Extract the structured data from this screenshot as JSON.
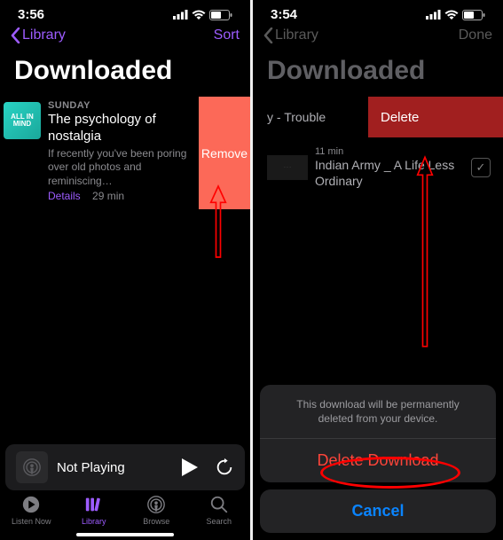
{
  "left": {
    "status": {
      "time": "3:56"
    },
    "nav": {
      "back": "Library",
      "sort": "Sort"
    },
    "title": "Downloaded",
    "episode": {
      "day": "SUNDAY",
      "title": "The psychology of nostalgia",
      "desc": "If recently you've been poring over old photos and reminiscing…",
      "details": "Details",
      "duration": "29 min"
    },
    "remove": "Remove",
    "now_playing": "Not Playing",
    "tabs": {
      "listen": "Listen Now",
      "library": "Library",
      "browse": "Browse",
      "search": "Search"
    },
    "thumb_text": "ALL\nIN\nMIND"
  },
  "right": {
    "status": {
      "time": "3:54"
    },
    "nav": {
      "back": "Library",
      "done": "Done"
    },
    "title": "Downloaded",
    "row1": {
      "label": "y - Trouble"
    },
    "delete": "Delete",
    "row2": {
      "min": "11 min",
      "title": "Indian Army _ A Life Less Ordinary"
    },
    "sheet": {
      "msg": "This download will be permanently deleted from your device.",
      "delete": "Delete Download",
      "cancel": "Cancel"
    }
  }
}
